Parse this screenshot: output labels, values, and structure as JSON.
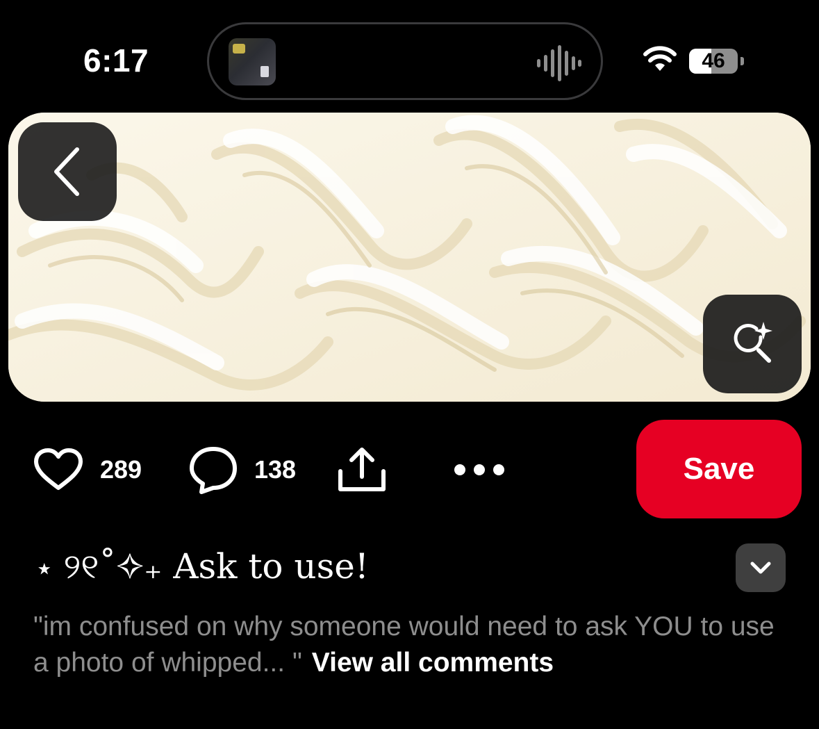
{
  "status_bar": {
    "time": "6:17",
    "battery_level": "46",
    "battery_fraction": 0.46,
    "icons": [
      "wifi-icon",
      "battery-icon",
      "audio-waveform-icon"
    ]
  },
  "pin": {
    "image_description_icon": "whipped-cream-image",
    "back_icon": "chevron-left-icon",
    "visual_search_icon": "sparkle-search-icon"
  },
  "actions": {
    "like_count": "289",
    "comment_count": "138",
    "save_label": "Save",
    "icons": [
      "heart-icon",
      "comment-bubble-icon",
      "share-upload-icon",
      "more-dots-icon"
    ]
  },
  "title": "⋆ ୨୧˚✧₊ Ask to use!",
  "comment": {
    "text": "\"im confused on why someone would need to ask YOU to use a photo of whipped... \"",
    "view_all_label": "View all comments"
  },
  "colors": {
    "save_red": "#e60023",
    "background": "#000000",
    "muted_text": "#8e8e8e"
  }
}
